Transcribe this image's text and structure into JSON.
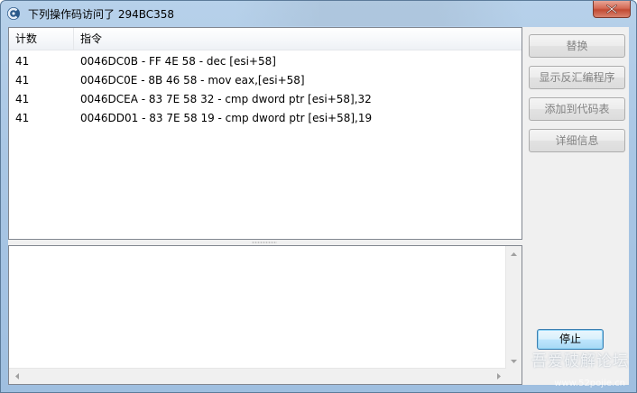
{
  "window": {
    "title": "下列操作码访问了 294BC358",
    "icon": "cheat-engine-icon"
  },
  "list": {
    "columns": [
      "计数",
      "指令"
    ],
    "rows": [
      {
        "count": "41",
        "instruction": "0046DC0B - FF 4E 58  - dec [esi+58]"
      },
      {
        "count": "41",
        "instruction": "0046DC0E - 8B 46 58  - mov eax,[esi+58]"
      },
      {
        "count": "41",
        "instruction": "0046DCEA - 83 7E 58 32 - cmp dword ptr [esi+58],32"
      },
      {
        "count": "41",
        "instruction": "0046DD01 - 83 7E 58 19 - cmp dword ptr [esi+58],19"
      }
    ]
  },
  "buttons": {
    "replace": "替换",
    "show_disassembler": "显示反汇编程序",
    "add_to_codelist": "添加到代码表",
    "more_info": "详细信息",
    "stop": "停止"
  },
  "watermark": {
    "text": "吾爱破解论坛",
    "url": "www.52pojie.cn"
  }
}
